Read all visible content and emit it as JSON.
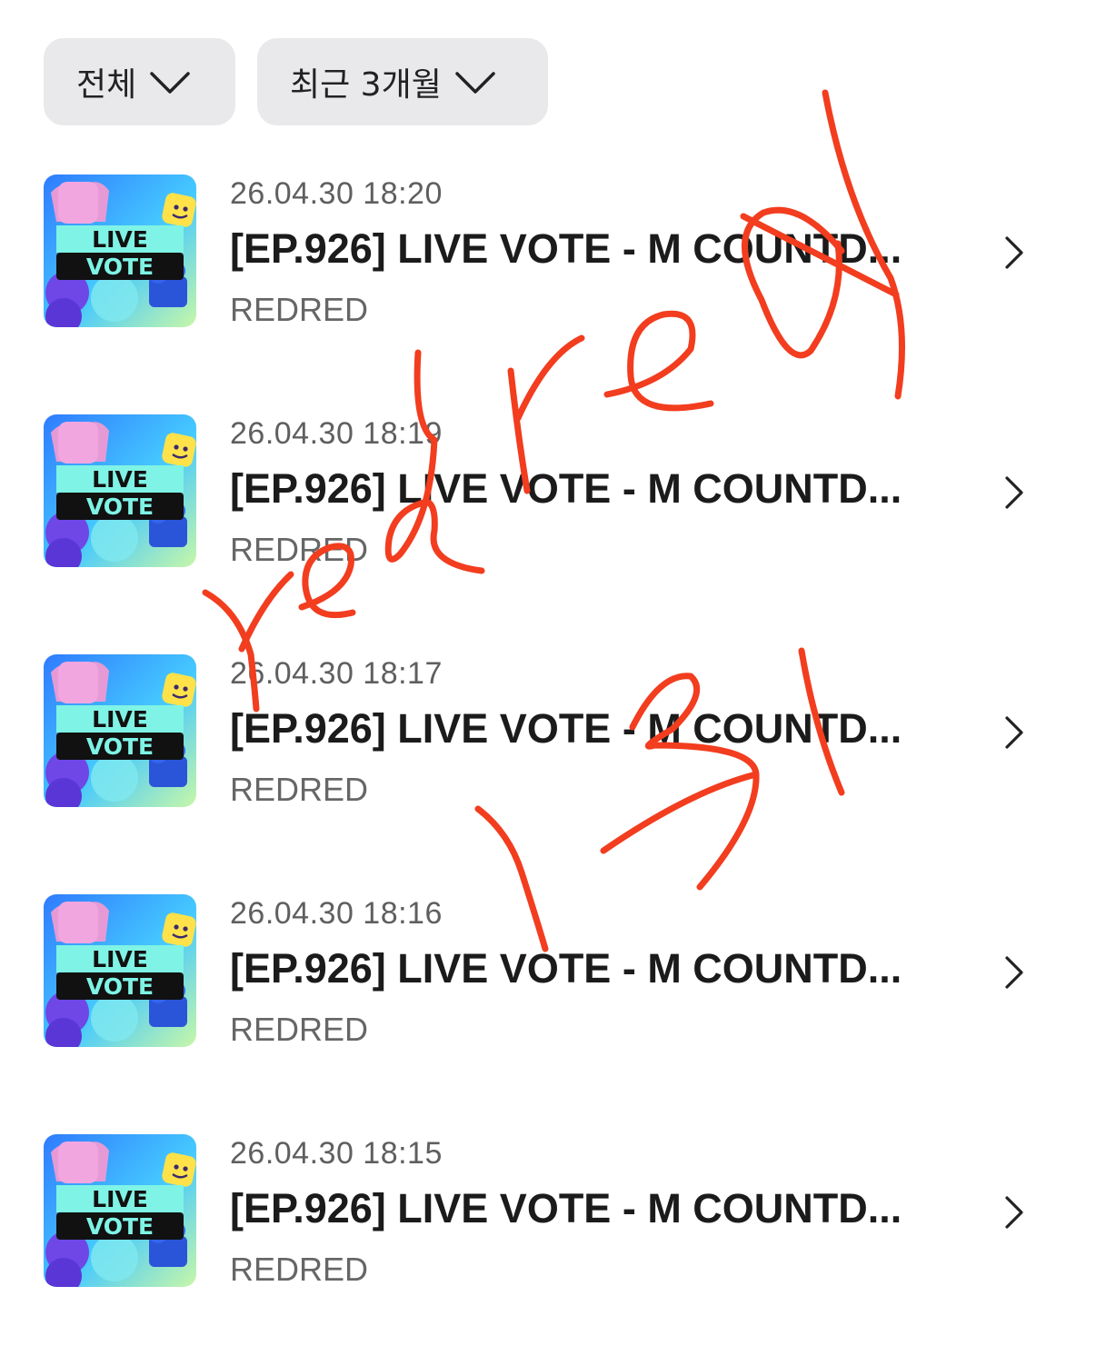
{
  "filters": {
    "all_label": "전체",
    "period_label": "최근 3개월"
  },
  "thumbnail": {
    "line1": "LIVE",
    "line2": "VOTE"
  },
  "items": [
    {
      "date": "26.04.30 18:20",
      "title": "[EP.926] LIVE VOTE - M COUNTD...",
      "artist": "REDRED"
    },
    {
      "date": "26.04.30 18:19",
      "title": "[EP.926] LIVE VOTE - M COUNTD...",
      "artist": "REDRED"
    },
    {
      "date": "26.04.30 18:17",
      "title": "[EP.926] LIVE VOTE - M COUNTD...",
      "artist": "REDRED"
    },
    {
      "date": "26.04.30 18:16",
      "title": "[EP.926] LIVE VOTE - M COUNTD...",
      "artist": "REDRED"
    },
    {
      "date": "26.04.30 18:15",
      "title": "[EP.926] LIVE VOTE - M COUNTD...",
      "artist": "REDRED"
    }
  ],
  "handwriting": {
    "text_1": "redred",
    "text_2": "131",
    "color": "#f23d1f"
  }
}
